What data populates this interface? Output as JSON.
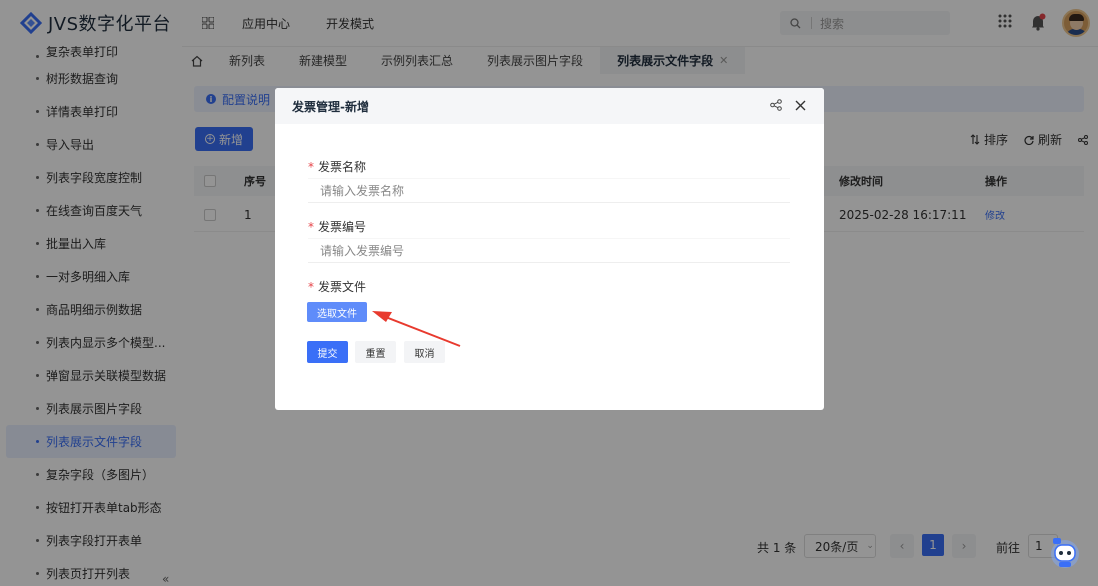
{
  "app": {
    "title": "JVS数字化平台"
  },
  "topnav": [
    "应用中心",
    "开发模式"
  ],
  "search": {
    "placeholder": "搜索"
  },
  "sidebar": {
    "items": [
      "复杂表单打印",
      "树形数据查询",
      "详情表单打印",
      "导入导出",
      "列表字段宽度控制",
      "在线查询百度天气",
      "批量出入库",
      "一对多明细入库",
      "商品明细示例数据",
      "列表内显示多个模型...",
      "弹窗显示关联模型数据",
      "列表展示图片字段",
      "列表展示文件字段",
      "复杂字段（多图片）",
      "按钮打开表单tab形态",
      "列表字段打开表单",
      "列表页打开列表"
    ],
    "active_index": 12,
    "collapse_glyph": "«"
  },
  "tabs": [
    "新列表",
    "新建模型",
    "示例列表汇总",
    "列表展示图片字段",
    "列表展示文件字段"
  ],
  "active_tab": "列表展示文件字段",
  "page": {
    "info_label": "配置说明",
    "add_label": "新增",
    "sort_label": "排序",
    "refresh_label": "刷新",
    "columns": {
      "index": "序号",
      "modified": "修改时间",
      "action": "操作"
    },
    "rows": [
      {
        "index": "1",
        "modified": "2025-02-28 16:17:11",
        "action": "修改"
      }
    ],
    "pager": {
      "total": "共 1 条",
      "page_size": "20条/页",
      "current": "1",
      "goto_label": "前往",
      "goto_value": "1"
    }
  },
  "modal": {
    "title": "发票管理-新增",
    "fields": [
      {
        "label": "发票名称",
        "placeholder": "请输入发票名称"
      },
      {
        "label": "发票编号",
        "placeholder": "请输入发票编号"
      },
      {
        "label": "发票文件"
      }
    ],
    "pick_file_label": "选取文件",
    "submit_label": "提交",
    "reset_label": "重置",
    "cancel_label": "取消"
  },
  "colors": {
    "primary": "#3a6ff7",
    "required": "#e6454a",
    "annotation_arrow": "#e83a2e"
  }
}
